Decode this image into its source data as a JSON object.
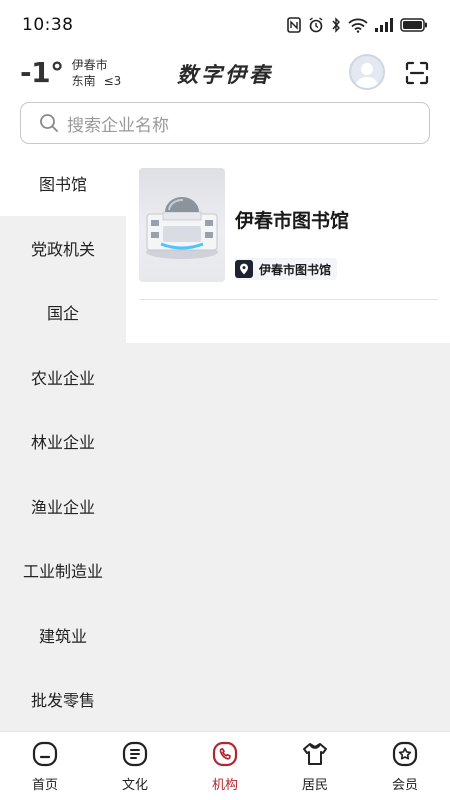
{
  "status_bar": {
    "time": "10:38"
  },
  "header": {
    "temperature": "-1°",
    "city": "伊春市",
    "wind_direction": "东南",
    "wind_level": "≤3",
    "app_title": "数字伊春"
  },
  "search": {
    "placeholder": "搜索企业名称"
  },
  "side_nav": {
    "items": [
      {
        "label": "图书馆"
      },
      {
        "label": "党政机关"
      },
      {
        "label": "国企"
      },
      {
        "label": "农业企业"
      },
      {
        "label": "林业企业"
      },
      {
        "label": "渔业企业"
      },
      {
        "label": "工业制造业"
      },
      {
        "label": "建筑业"
      },
      {
        "label": "批发零售"
      }
    ],
    "selected": "图书馆"
  },
  "results": [
    {
      "name": "伊春市图书馆",
      "tag": "伊春市图书馆"
    }
  ],
  "tabbar": {
    "items": [
      {
        "label": "首页",
        "icon": "home-icon"
      },
      {
        "label": "文化",
        "icon": "culture-icon"
      },
      {
        "label": "机构",
        "icon": "institution-icon"
      },
      {
        "label": "居民",
        "icon": "resident-icon"
      },
      {
        "label": "会员",
        "icon": "member-icon"
      }
    ],
    "active": "机构"
  },
  "colors": {
    "accent": "#b3262f",
    "panel_bg": "#f0f0f0",
    "tag_icon_bg": "#1e2130"
  }
}
